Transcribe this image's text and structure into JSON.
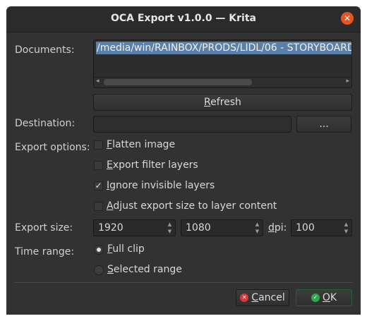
{
  "window": {
    "title": "OCA Export  v1.0.0 — Krita",
    "close_symbol": "✕"
  },
  "documents": {
    "label": "Documents:",
    "items": [
      "/media/win/RAINBOX/PRODS/LIDL/06 - STORYBOARD"
    ],
    "scroll_left": "◂",
    "scroll_right": "▸"
  },
  "refresh": {
    "label_pre": "",
    "label_u": "R",
    "label_post": "efresh"
  },
  "destination": {
    "label": "Destination:",
    "value": "",
    "browse_label": "..."
  },
  "export_options": {
    "label": "Export options:",
    "items": [
      {
        "pre": "",
        "u": "F",
        "post": "latten image",
        "checked": false
      },
      {
        "pre": "",
        "u": "E",
        "post": "xport filter layers",
        "checked": false
      },
      {
        "pre": "",
        "u": "I",
        "post": "gnore invisible layers",
        "checked": true
      },
      {
        "pre": "",
        "u": "A",
        "post": "djust export size to layer content",
        "checked": false
      }
    ],
    "check_mark": "✓"
  },
  "export_size": {
    "label": "Export size:",
    "width": "1920",
    "height": "1080",
    "dpi_label_u": "d",
    "dpi_label_post": "pi:",
    "dpi": "100",
    "spin_up": "▲",
    "spin_down": "▼"
  },
  "time_range": {
    "label": "Time range:",
    "options": [
      {
        "pre": "",
        "u": "F",
        "post": "ull clip",
        "selected": true
      },
      {
        "pre": "",
        "u": "S",
        "post": "elected range",
        "selected": false
      }
    ]
  },
  "buttons": {
    "cancel": {
      "pre": "",
      "u": "C",
      "post": "ancel",
      "icon": "✕"
    },
    "ok": {
      "pre": "",
      "u": "O",
      "post": "K",
      "icon": "✓"
    }
  },
  "colors": {
    "accent": "#e95420",
    "selection": "#5a7fa8",
    "ok_green": "#2fa84f",
    "cancel_red": "#d8383a"
  }
}
